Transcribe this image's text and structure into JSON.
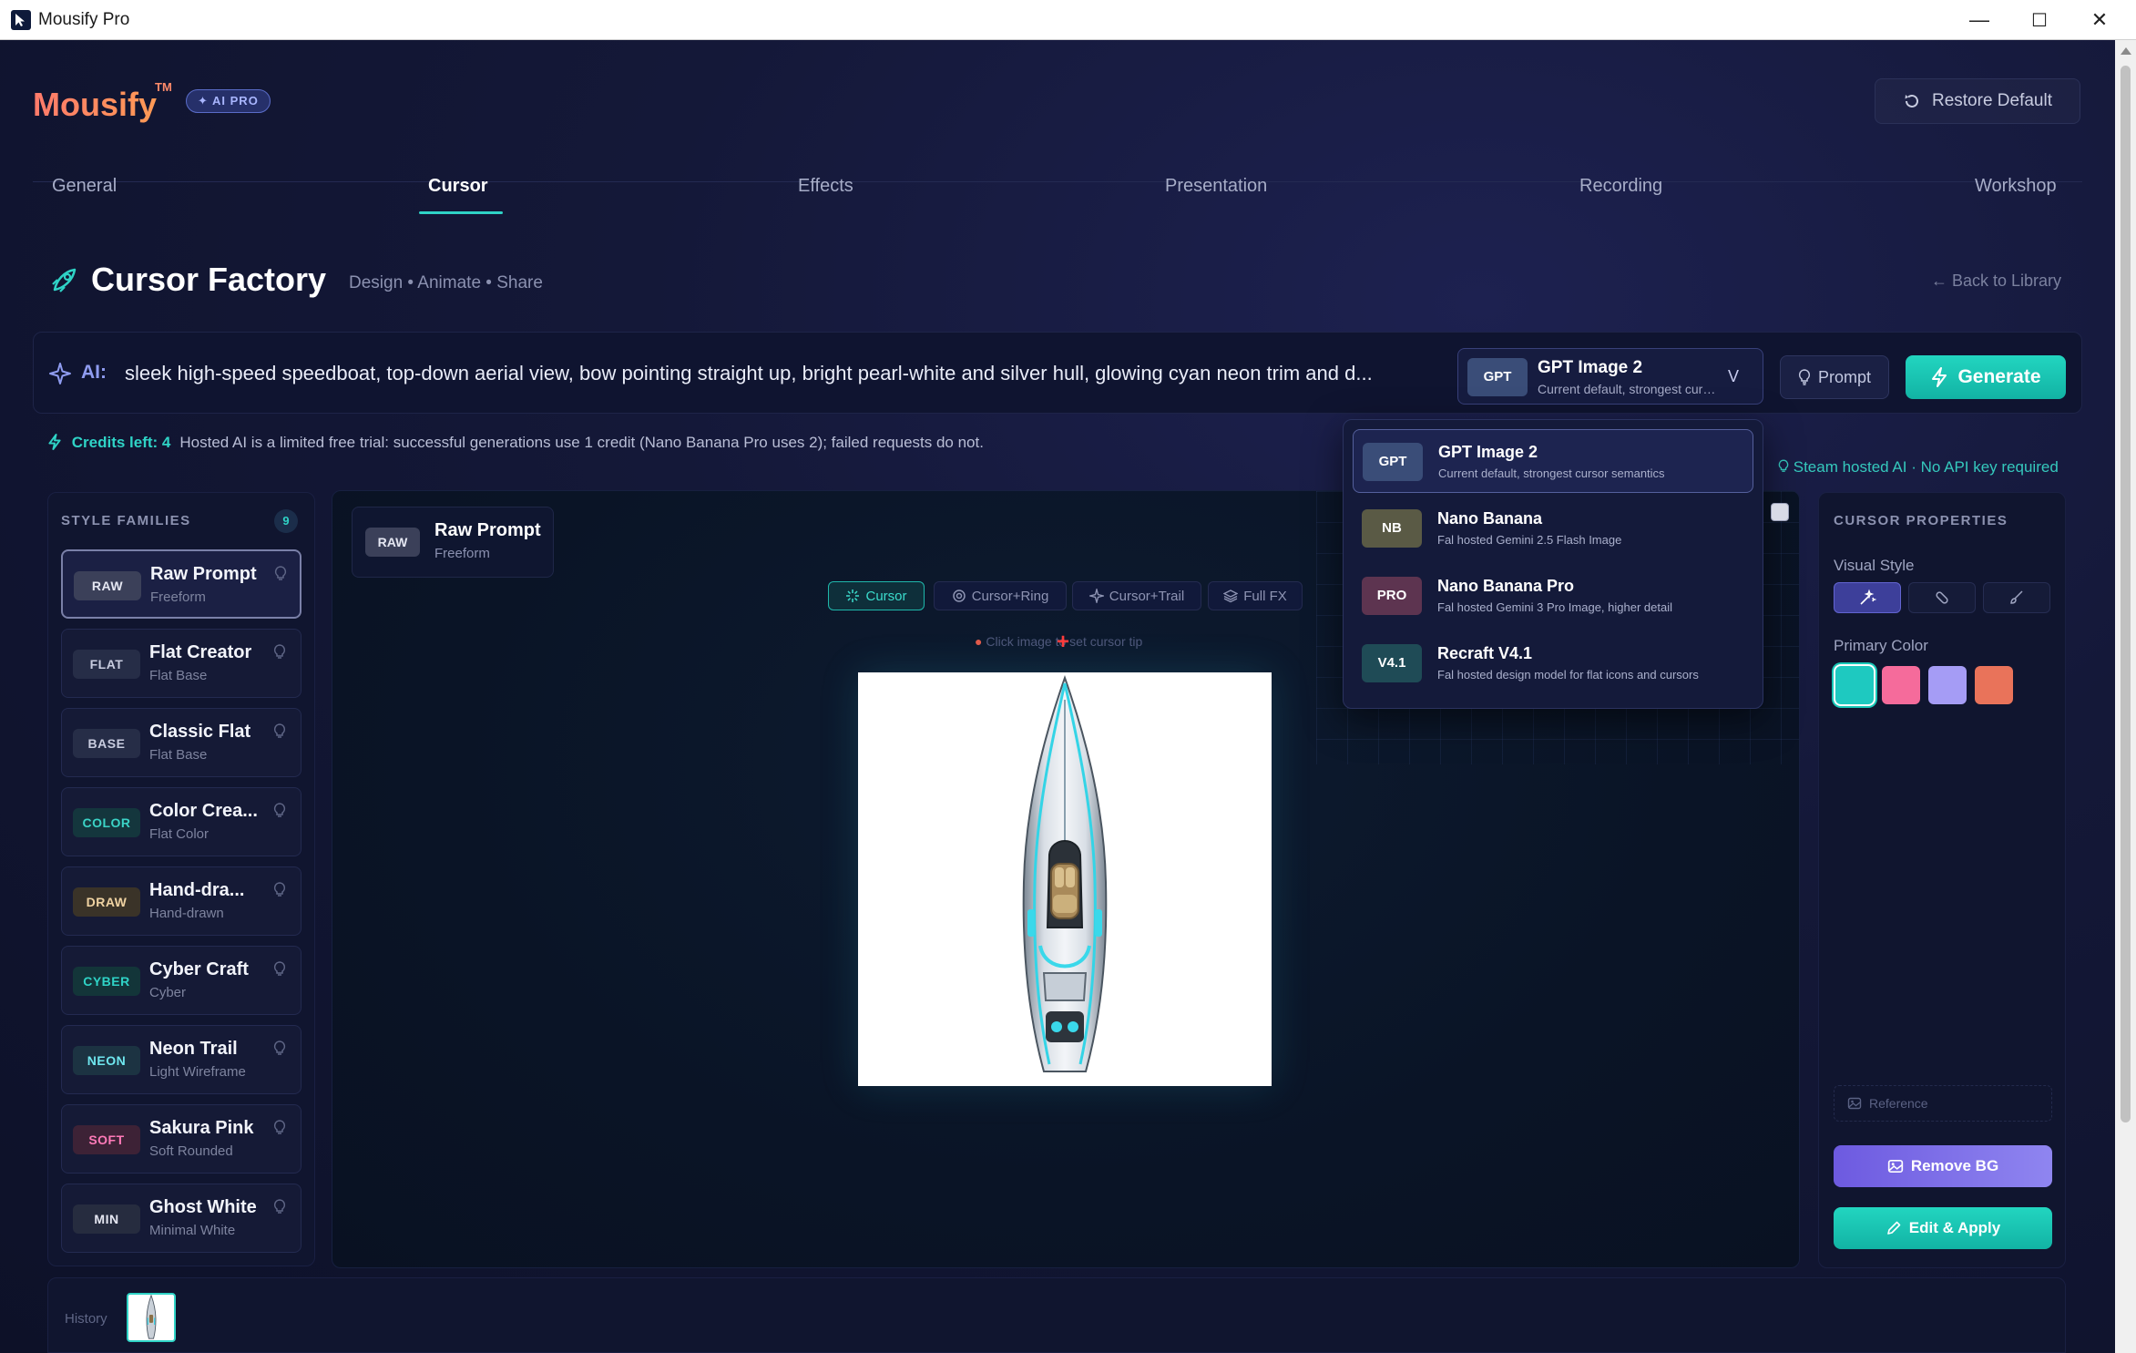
{
  "window": {
    "title": "Mousify Pro",
    "controls": {
      "minimize": "—",
      "maximize": "☐",
      "close": "✕"
    }
  },
  "brand": {
    "name": "Mousify",
    "tm": "TM",
    "badge": "✦ AI PRO"
  },
  "header": {
    "restore_label": "Restore Default"
  },
  "tabs": [
    {
      "label": "General"
    },
    {
      "label": "Cursor",
      "active": true
    },
    {
      "label": "Effects"
    },
    {
      "label": "Presentation"
    },
    {
      "label": "Recording"
    },
    {
      "label": "Workshop"
    }
  ],
  "factory": {
    "title": "Cursor Factory",
    "subtitle": "Design • Animate • Share",
    "back_link": "← Back to Library"
  },
  "ai_bar": {
    "label": "AI:",
    "prompt": "sleek high-speed speedboat, top-down aerial view, bow pointing straight up, bright pearl-white and silver hull, glowing cyan neon trim and d...",
    "selected_model": {
      "tag": "GPT",
      "name": "GPT Image 2",
      "desc": "Current default, strongest cursor semantics",
      "chevron": "V"
    },
    "prompt_button": "Prompt",
    "generate_button": "Generate"
  },
  "credits": {
    "label": "Credits left: 4",
    "note": "Hosted AI is a limited free trial: successful generations use 1 credit (Nano Banana Pro uses 2); failed requests do not."
  },
  "steam_note": "Steam hosted AI · No API key required",
  "model_dropdown": [
    {
      "tag": "GPT",
      "name": "GPT Image 2",
      "desc": "Current default, strongest cursor semantics",
      "color": "#3a4d78",
      "active": true
    },
    {
      "tag": "NB",
      "name": "Nano Banana",
      "desc": "Fal hosted Gemini 2.5 Flash Image",
      "color": "#5a5a45"
    },
    {
      "tag": "PRO",
      "name": "Nano Banana Pro",
      "desc": "Fal hosted Gemini 3 Pro Image, higher detail",
      "color": "#5d3450"
    },
    {
      "tag": "V4.1",
      "name": "Recraft V4.1",
      "desc": "Fal hosted design model for flat icons and cursors",
      "color": "#1f4b56"
    }
  ],
  "style_families": {
    "heading": "STYLE FAMILIES",
    "count": "9",
    "items": [
      {
        "tag": "RAW",
        "name": "Raw Prompt",
        "sub": "Freeform",
        "tag_bg": "#3b4059",
        "tag_fg": "#e5e7f2",
        "selected": true
      },
      {
        "tag": "FLAT",
        "name": "Flat Creator",
        "sub": "Flat Base",
        "tag_bg": "#262d47",
        "tag_fg": "#c9cde0"
      },
      {
        "tag": "BASE",
        "name": "Classic Flat",
        "sub": "Flat Base",
        "tag_bg": "#262d47",
        "tag_fg": "#c9cde0"
      },
      {
        "tag": "COLOR",
        "name": "Color Crea...",
        "sub": "Flat Color",
        "tag_bg": "#14363d",
        "tag_fg": "#3bd3c6"
      },
      {
        "tag": "DRAW",
        "name": "Hand-dra...",
        "sub": "Hand-drawn",
        "tag_bg": "#3a3328",
        "tag_fg": "#f0d3a2"
      },
      {
        "tag": "CYBER",
        "name": "Cyber Craft",
        "sub": "Cyber",
        "tag_bg": "#133539",
        "tag_fg": "#2fd3c6"
      },
      {
        "tag": "NEON",
        "name": "Neon Trail",
        "sub": "Light Wireframe",
        "tag_bg": "#1c3342",
        "tag_fg": "#6fe7ef"
      },
      {
        "tag": "SOFT",
        "name": "Sakura Pink",
        "sub": "Soft Rounded",
        "tag_bg": "#3d2236",
        "tag_fg": "#ff7ab8"
      },
      {
        "tag": "MIN",
        "name": "Ghost White",
        "sub": "Minimal White",
        "tag_bg": "#262c3f",
        "tag_fg": "#e5e7f2"
      }
    ]
  },
  "workspace": {
    "current": {
      "tag": "RAW",
      "name": "Raw Prompt",
      "sub": "Freeform"
    },
    "modes": [
      {
        "label": "Cursor",
        "icon": "sparkle-icon",
        "active": true
      },
      {
        "label": "Cursor+Ring",
        "icon": "ring-icon"
      },
      {
        "label": "Cursor+Trail",
        "icon": "trail-icon"
      },
      {
        "label": "Full FX",
        "icon": "layers-icon"
      }
    ],
    "hint": "Click image to set cursor tip",
    "tip_marker": "+"
  },
  "cursor_properties": {
    "heading": "CURSOR PROPERTIES",
    "visual_style_label": "Visual Style",
    "visual_styles": [
      "magic-wand-icon",
      "pill-icon",
      "brush-icon"
    ],
    "primary_color_label": "Primary Color",
    "colors": [
      "#1ec9c0",
      "#f56b9b",
      "#a59cf5",
      "#e9735a"
    ],
    "reference_label": "Reference",
    "remove_bg_label": "Remove BG",
    "edit_apply_label": "Edit & Apply"
  },
  "history": {
    "label": "History"
  }
}
